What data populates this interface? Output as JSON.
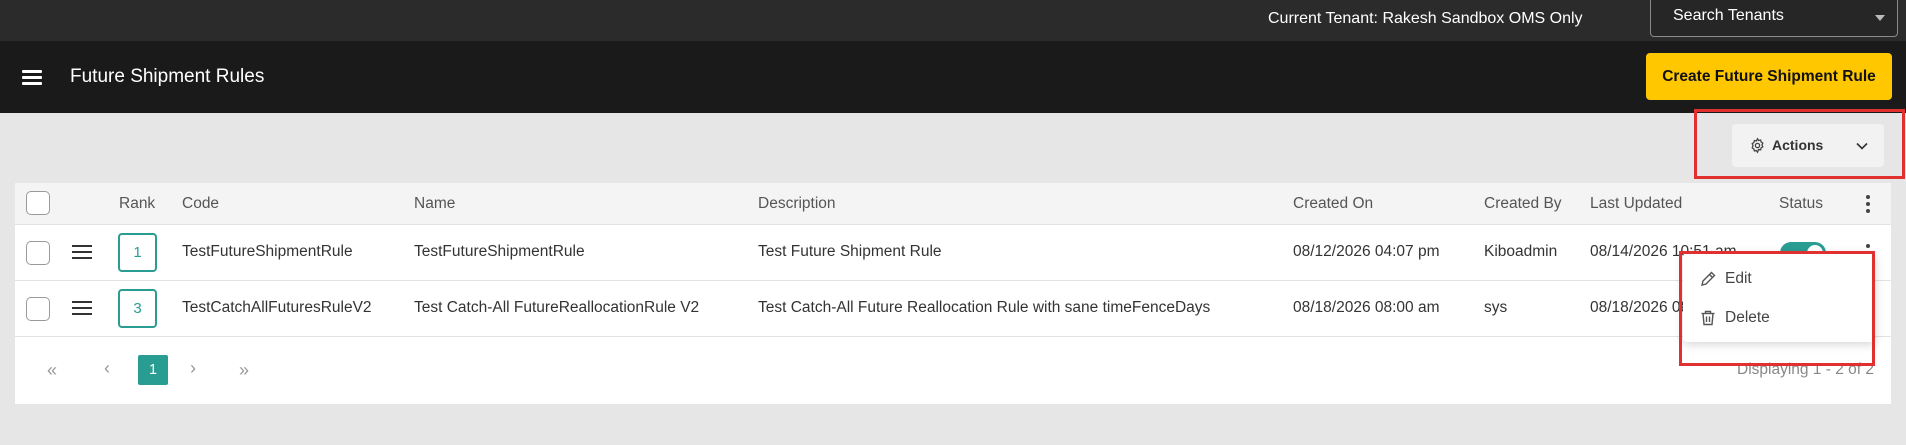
{
  "topbar": {
    "tenant_label": "Current Tenant: Rakesh Sandbox OMS Only",
    "search_tenants_label": "Search Tenants"
  },
  "header": {
    "title": "Future Shipment Rules",
    "create_button_label": "Create Future Shipment Rule"
  },
  "toolbar": {
    "actions_label": "Actions"
  },
  "table": {
    "columns": {
      "rank": "Rank",
      "code": "Code",
      "name": "Name",
      "description": "Description",
      "created_on": "Created On",
      "created_by": "Created By",
      "last_updated": "Last Updated",
      "status": "Status"
    },
    "rows": [
      {
        "rank": "1",
        "code": "TestFutureShipmentRule",
        "name": "TestFutureShipmentRule",
        "description": "Test Future Shipment Rule",
        "created_on": "08/12/2026 04:07 pm",
        "created_by": "Kiboadmin",
        "last_updated": "08/14/2026 10:51 am",
        "status_enabled": true
      },
      {
        "rank": "3",
        "code": "TestCatchAllFuturesRuleV2",
        "name": "Test Catch-All FutureReallocationRule V2",
        "description": "Test Catch-All Future Reallocation Rule with sane timeFenceDays",
        "created_on": "08/18/2026 08:00 am",
        "created_by": "sys",
        "last_updated": "08/18/2026 08:00 am",
        "status_enabled": true
      }
    ]
  },
  "pagination": {
    "first": "«",
    "prev": "‹",
    "current_page": "1",
    "next": "›",
    "last": "»",
    "displaying": "Displaying 1 - 2 of 2"
  },
  "row_menu": {
    "items": [
      {
        "label": "Edit",
        "icon": "pencil-icon"
      },
      {
        "label": "Delete",
        "icon": "trash-icon"
      }
    ]
  },
  "colors": {
    "accent": "#2a9d93",
    "primary_button": "#ffc700",
    "highlight_box": "#e03030"
  }
}
